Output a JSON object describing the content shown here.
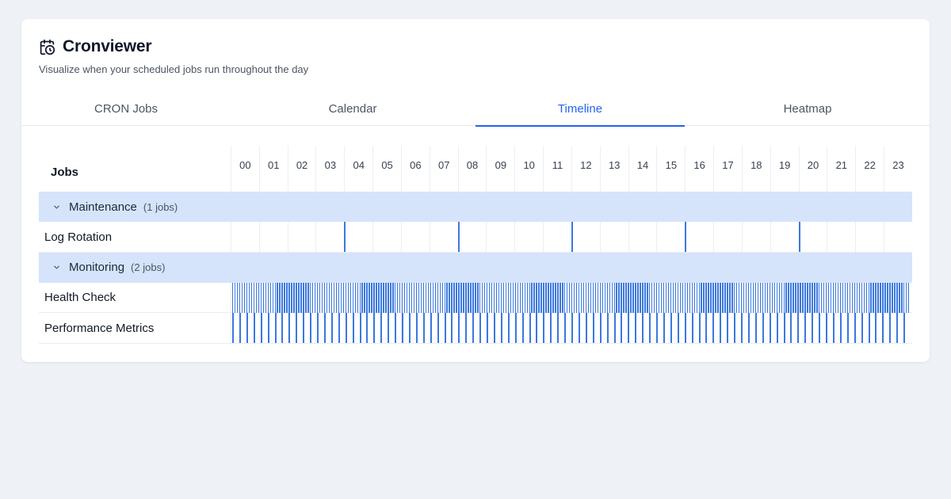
{
  "app": {
    "title": "Cronviewer",
    "subtitle": "Visualize when your scheduled jobs run throughout the day",
    "icon": "calendar-clock-icon"
  },
  "tabs": [
    {
      "label": "CRON Jobs",
      "active": false
    },
    {
      "label": "Calendar",
      "active": false
    },
    {
      "label": "Timeline",
      "active": true
    },
    {
      "label": "Heatmap",
      "active": false
    }
  ],
  "timeline": {
    "jobs_header": "Jobs",
    "hours": [
      "00",
      "01",
      "02",
      "03",
      "04",
      "05",
      "06",
      "07",
      "08",
      "09",
      "10",
      "11",
      "12",
      "13",
      "14",
      "15",
      "16",
      "17",
      "18",
      "19",
      "20",
      "21",
      "22",
      "23"
    ],
    "groups": [
      {
        "name": "Maintenance",
        "count_label": "(1 jobs)",
        "jobs": [
          {
            "name": "Log Rotation",
            "runs_per_day": 5,
            "run_hours": [
              4,
              8,
              12,
              16,
              20
            ]
          }
        ]
      },
      {
        "name": "Monitoring",
        "count_label": "(2 jobs)",
        "jobs": [
          {
            "name": "Health Check",
            "interval_minutes": 5
          },
          {
            "name": "Performance Metrics",
            "interval_minutes": 15
          }
        ]
      }
    ]
  },
  "colors": {
    "accent": "#2563eb",
    "mark": "#3b78e0",
    "group_bg": "#d5e4fb",
    "page_bg": "#eef2f7"
  }
}
